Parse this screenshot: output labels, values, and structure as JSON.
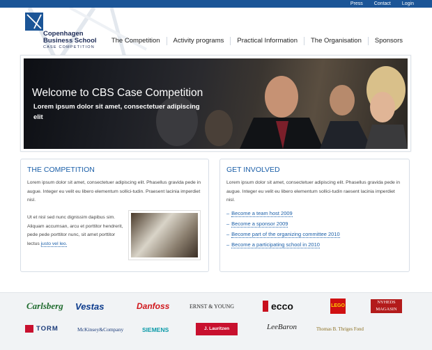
{
  "topnav": {
    "press": "Press",
    "contact": "Contact",
    "login": "Login"
  },
  "logo": {
    "line1": "Copenhagen",
    "line2": "Business School",
    "line3": "CASE COMPETITION"
  },
  "mainnav": [
    "The Competition",
    "Activity programs",
    "Practical Information",
    "The Organisation",
    "Sponsors"
  ],
  "hero": {
    "title": "Welcome to CBS Case Competition",
    "subtitle": "Lorem ipsum dolor sit amet, consectetuer adipiscing elit"
  },
  "competition": {
    "heading": "THE COMPETITION",
    "para1": "Lorem ipsum dolor sit amet, consectetuer adipiscing elit. Phasellus gravida pede in augue. Integer eu velit eu libero elementum sollici-tudin. Praesent lacinia imperdiet nisl.",
    "para2": "Ut et nisl sed nunc dignissim dapibus sim. Aliquam accumsan, arcu et porttitor hendrerit, pede pede porttitor nunc, sit amet porttitor lectus",
    "link": "justo vel leo."
  },
  "involved": {
    "heading": "GET INVOLVED",
    "para": "Lorem ipsum dolor sit amet, consectetuer adipiscing elit. Phasellus gravida pede in augue. Integer eu velit eu libero elementum sollici-tudin raesent lacinia imperdiet nisl.",
    "links": [
      "Become a team host 2009",
      "Become a sponsor 2009",
      "Become part of the organizing committee 2010",
      "Become a participating school in 2010"
    ]
  },
  "sponsors": [
    "Carlsberg",
    "Vestas",
    "Danfoss",
    "ERNST & YOUNG",
    "ecco",
    "LEGO",
    "NYHEDS MAGASIN",
    "TORM",
    "McKinsey&Company",
    "SIEMENS",
    "J. Lauritzen",
    "LeeBaron",
    "Thomas B. Thriges Fond"
  ],
  "colors": {
    "brand_blue": "#1b5597",
    "link_blue": "#1b5fa8"
  }
}
